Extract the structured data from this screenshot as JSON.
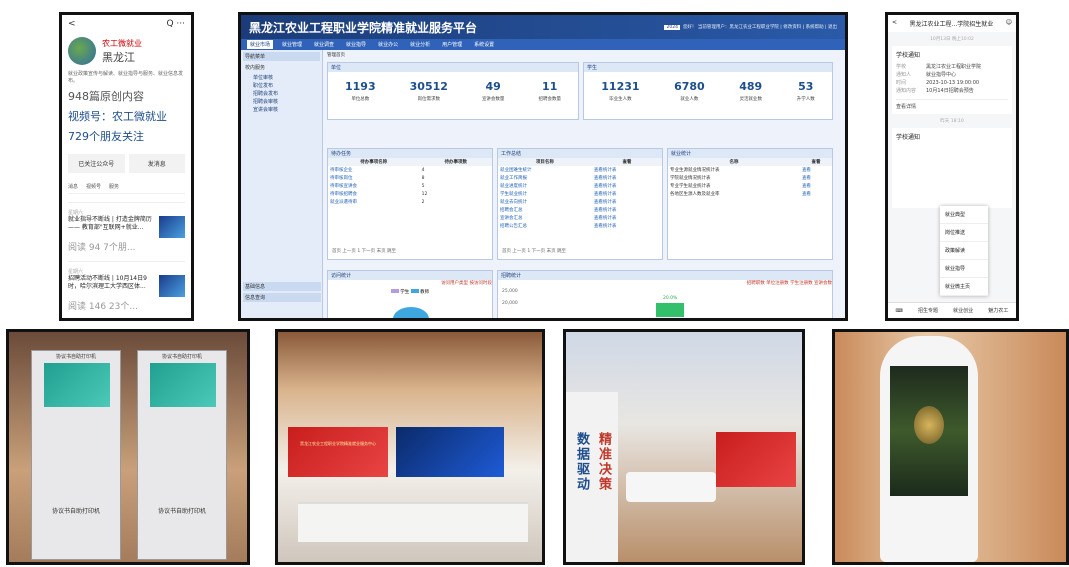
{
  "phone1": {
    "back": "<",
    "icons": "Q ···",
    "account": "农工微就业",
    "location": "黑龙江",
    "desc": "就业政策宣传与解读、就业指导与服务、就业信息发布。",
    "articles": "948篇原创内容",
    "video": "视频号：农工微就业",
    "friends": "729个朋友关注",
    "follow_btn": "已关注公众号",
    "msg_btn": "发消息",
    "tabs": [
      "消息",
      "视频号",
      "服务"
    ],
    "posts": [
      {
        "tag": "星期六",
        "title": "就业指导不断线 | 打造金牌简历 —— 教育部\"互联网+就业...",
        "read": "阅读 94  7个朋..."
      },
      {
        "tag": "星期六",
        "title": "招聘活动不断线 | 10月14日9时，哈尔滨理工大学西区体...",
        "read": "阅读 146  23个..."
      }
    ]
  },
  "desktop": {
    "title": "黑龙江农业工程职业学院精准就业服务平台",
    "header_right": "您好！ 当前管理用户：黑龙江农业工程职业学院 | 修改资料 | 系统帮助 | 退出",
    "year": "2024",
    "nav": [
      "就业市场",
      "就业管理",
      "就业调查",
      "就业指导",
      "就业办公",
      "就业分析",
      "用户管理",
      "系统设置"
    ],
    "side_title": "导航菜单",
    "side_group": "校内服务",
    "side_items": [
      "单位审核",
      "职位发布",
      "招聘会发布",
      "招聘会审核",
      "宣讲会审核"
    ],
    "side_bottom": [
      "基础信息",
      "信息查询"
    ],
    "crumb": "管理首页",
    "unit_box": "单位",
    "unit_stats": [
      {
        "n": "1193",
        "l": "单位总数"
      },
      {
        "n": "30512",
        "l": "岗位需求数"
      },
      {
        "n": "49",
        "l": "宣讲会数量"
      },
      {
        "n": "11",
        "l": "招聘会数量"
      }
    ],
    "student_box": "学生",
    "student_stats": [
      {
        "n": "11231",
        "l": "毕业生人数"
      },
      {
        "n": "6780",
        "l": "就业人数"
      },
      {
        "n": "489",
        "l": "灵活就业数"
      },
      {
        "n": "53",
        "l": "升学人数"
      }
    ],
    "todo_box": "待办任务",
    "todo_headers": [
      "待办事项名称",
      "待办事项数"
    ],
    "todo_rows": [
      [
        "待审核企业",
        "4"
      ],
      [
        "待审核岗位",
        "8"
      ],
      [
        "待审核宣讲会",
        "5"
      ],
      [
        "待审核招聘会",
        "12"
      ],
      [
        "就业派遣待审",
        "2"
      ]
    ],
    "work_box": "工作总结",
    "work_headers": [
      "项目名称",
      "查看"
    ],
    "work_rows": [
      [
        "就业困难生统计",
        "查看统计表"
      ],
      [
        "就业工作简报",
        "查看统计表"
      ],
      [
        "就业进度统计",
        "查看统计表"
      ],
      [
        "学生就业统计",
        "查看统计表"
      ],
      [
        "就业去向统计",
        "查看统计表"
      ],
      [
        "招聘会汇总",
        "查看统计表"
      ],
      [
        "宣讲会汇总",
        "查看统计表"
      ],
      [
        "招聘公告汇总",
        "查看统计表"
      ]
    ],
    "report_box": "就业统计",
    "report_headers": [
      "名称",
      "查看"
    ],
    "report_rows": [
      [
        "专业生源就业情况统计表",
        "查看"
      ],
      [
        "学院就业情况统计表",
        "查看"
      ],
      [
        "专业学生就业统计表",
        "查看"
      ],
      [
        "各地区生源人数及就业率",
        "查看"
      ]
    ],
    "pager": "首页 上一页 1 下一页 末页 跳至",
    "trend_box": "访问统计",
    "chart_legend": [
      "学生",
      "教师"
    ],
    "chart_links": "访问用户类型 按访问时段",
    "reg_box": "招聘统计",
    "reg_links": "招聘职数 单位注册数 学生注册数 宣讲会数",
    "y1": "25,000",
    "y2": "20,000",
    "pct": "20.0%"
  },
  "phone3": {
    "back": "<",
    "title": "黑龙江农业工程...学院招生就业",
    "date1": "10月13日 晚上10:02",
    "card_title": "学校通知",
    "fields": [
      [
        "学校",
        "黑龙江农业工程职业学院"
      ],
      [
        "通知人",
        "就业指导中心"
      ],
      [
        "时间",
        "2023-10-13 19:00:00"
      ],
      [
        "通知内容",
        "10月14日招聘会预告"
      ]
    ],
    "detail": "查看详情",
    "date2": "昨天 18:10",
    "card2_title": "学校通知",
    "menu": [
      "就业典型",
      "岗位推送",
      "政策解读",
      "就业指导",
      "就业微主页"
    ],
    "bottom": [
      "招生专题",
      "就业创业",
      "魅力农工"
    ]
  },
  "photos": {
    "kiosk_label": "协议书自助打印机",
    "kiosk_top": "协议书自助打印机",
    "wall_text": "黑龙江农业工程职业学院精准就业服务中心",
    "chars_left": "数据驱动",
    "chars_right": "精准决策"
  }
}
